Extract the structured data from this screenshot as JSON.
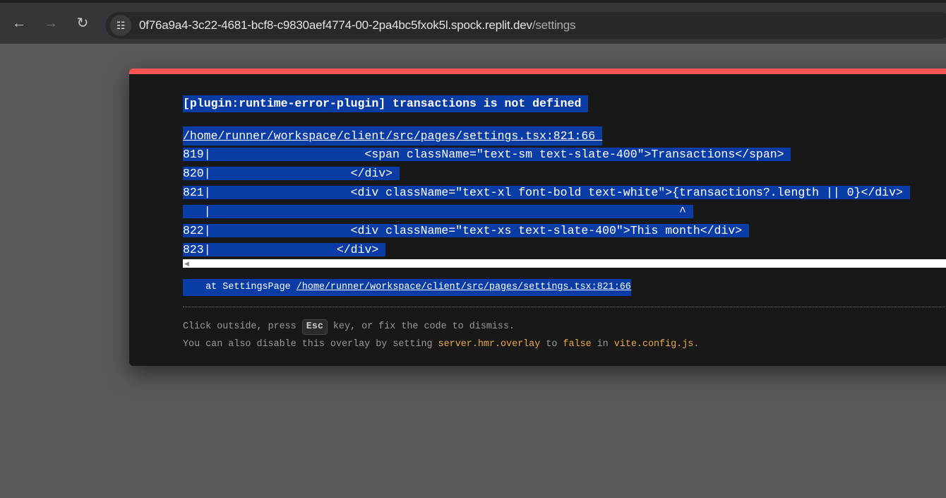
{
  "browser": {
    "back_icon": "arrow-left",
    "forward_icon": "arrow-right",
    "reload_icon": "reload",
    "url_host": "0f76a9a4-3c22-4681-bcf8-c9830aef4774-00-2pa4bc5fxok5l.spock.replit.dev",
    "url_path": "/settings"
  },
  "overlay": {
    "accent_color": "#ff5555",
    "message": "[plugin:runtime-error-plugin] transactions is not defined ",
    "file": "/home/runner/workspace/client/src/pages/settings.tsx:821:66 ",
    "code_lines": [
      "819|                      <span className=\"text-sm text-slate-400\">Transactions</span> ",
      "820|                    </div> ",
      "821|                    <div className=\"text-xl font-bold text-white\">{transactions?.length || 0}</div> ",
      "   |                                                                   ^ ",
      "822|                    <div className=\"text-xs text-slate-400\">This month</div> ",
      "823|                  </div> "
    ],
    "stack_prefix": "    at SettingsPage ",
    "stack_link": "/home/runner/workspace/client/src/pages/settings.tsx:821:66",
    "tip1_a": "Click outside, press ",
    "tip1_key": "Esc",
    "tip1_b": " key, or fix the code to dismiss.",
    "tip2_a": "You can also disable this overlay by setting ",
    "tip2_opt": "server.hmr.overlay",
    "tip2_b": " to ",
    "tip2_false": "false",
    "tip2_c": " in ",
    "tip2_file": "vite.config.js",
    "tip2_d": "."
  }
}
